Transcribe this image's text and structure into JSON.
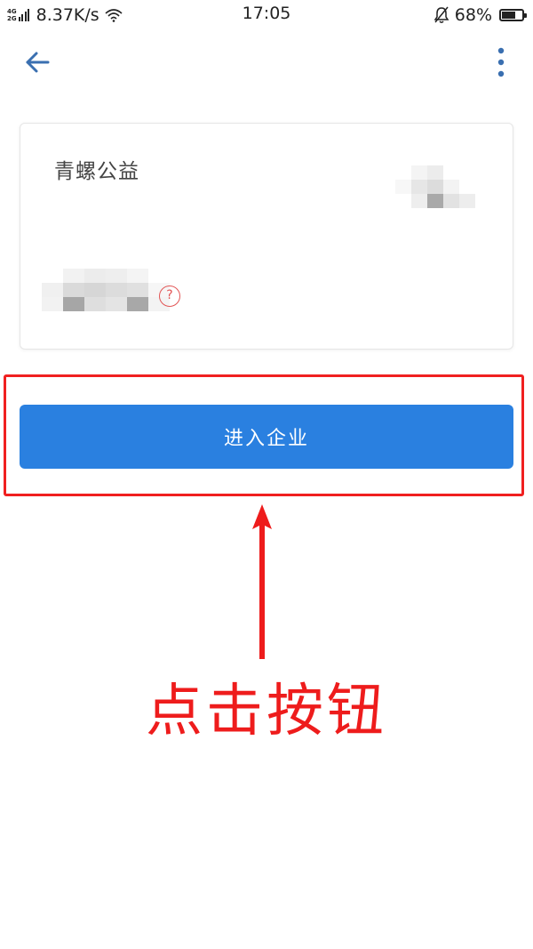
{
  "status_bar": {
    "network_type_top": "4G",
    "network_type_bottom": "2G",
    "net_speed": "8.37K/s",
    "time": "17:05",
    "battery_percent": "68%",
    "battery_level": 0.68
  },
  "nav": {
    "back_icon": "arrow-left-icon",
    "more_icon": "more-vertical-icon",
    "accent_color": "#3a6fb0"
  },
  "card": {
    "org_name": "青螺公益",
    "help_symbol": "?"
  },
  "primary_button": {
    "label": "进入企业",
    "color": "#2a80e0"
  },
  "annotation": {
    "text": "点击按钮",
    "color": "#ee1c1c"
  }
}
